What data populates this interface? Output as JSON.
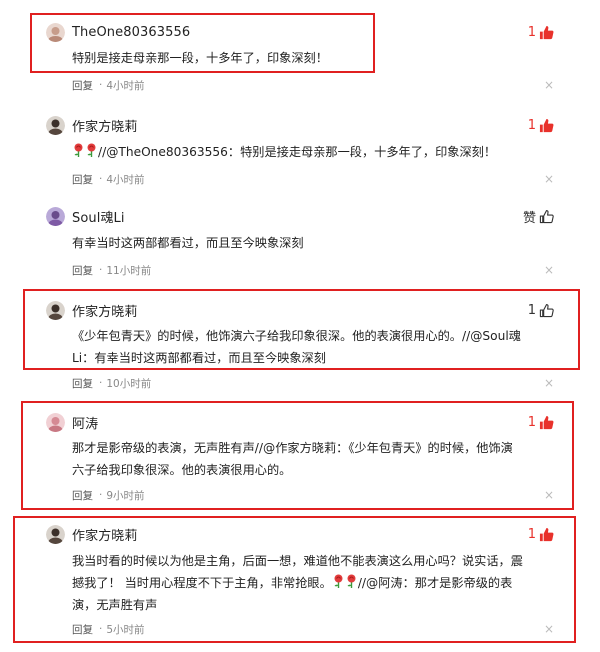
{
  "colors": {
    "accent": "#e8312b",
    "highlight_border": "#e02020",
    "meta": "#888888"
  },
  "ui": {
    "reply": "回复",
    "dot": "·",
    "close": "×",
    "like_word": "赞",
    "flower_icon": "rose-icon"
  },
  "comments": [
    {
      "user": "TheOne80363556",
      "likes": "1",
      "liked": true,
      "lines": [
        "特别是接走母亲那一段，十多年了，印象深刻！"
      ],
      "time": "4小时前"
    },
    {
      "user": "作家方晓莉",
      "likes": "1",
      "liked": true,
      "prefix": "//@TheOne80363556：特别是接走母亲那一段，十多年了，印象深刻！",
      "time": "4小时前"
    },
    {
      "user": "Soul魂Li",
      "likes": "赞",
      "liked": false,
      "lines": [
        "有幸当时这两部都看过，而且至今映象深刻"
      ],
      "time": "11小时前"
    },
    {
      "user": "作家方晓莉",
      "likes": "1",
      "liked": false,
      "lines": [
        "《少年包青天》的时候，他饰演六子给我印象很深。他的表演很用心的。//@Soul魂",
        "Li：有幸当时这两部都看过，而且至今映象深刻"
      ],
      "time": "10小时前"
    },
    {
      "user": "阿涛",
      "likes": "1",
      "liked": true,
      "lines": [
        "那才是影帝级的表演，无声胜有声//@作家方晓莉：《少年包青天》的时候，他饰演",
        "六子给我印象很深。他的表演很用心的。"
      ],
      "time": "9小时前"
    },
    {
      "user": "作家方晓莉",
      "likes": "1",
      "liked": true,
      "lines": [
        "我当时看的时候以为他是主角，后面一想，难道他不能表演这么用心吗？说实话，震",
        "撼我了！ 当时用心程度不下于主角，非常抢眼。"
      ],
      "line2_suffix": "//@阿涛：那才是影帝级的表",
      "line3": "演，无声胜有声",
      "time": "5小时前"
    }
  ]
}
